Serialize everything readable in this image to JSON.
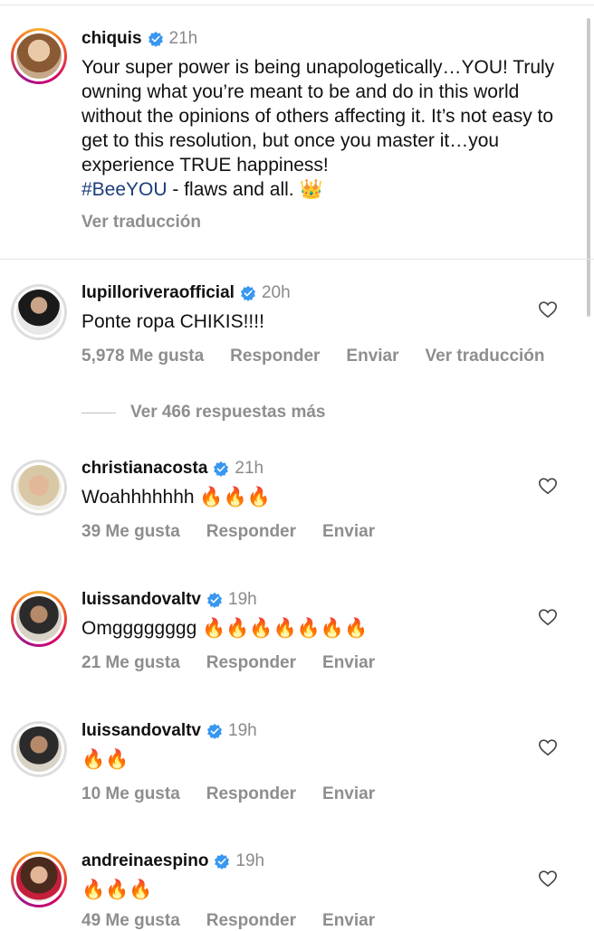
{
  "post": {
    "username": "chiquis",
    "time": "21h",
    "caption": "Your super power is being unapologetically…YOU! Truly owning what you’re meant to be and do in this world without the opinions of others affecting it. It’s not easy to get to this resolution, but once you master it…you experience TRUE happiness!",
    "hashtag": "#BeeYOU",
    "caption_end": " - flaws and all. 👑",
    "translate_label": "Ver traducción"
  },
  "comments": [
    {
      "username": "lupilloriveraofficial",
      "time": "20h",
      "text": "Ponte ropa CHIKIS!!!!",
      "likes": "5,978 Me gusta",
      "reply": "Responder",
      "send": "Enviar",
      "translate": "Ver traducción",
      "more_replies": "Ver 466 respuestas más"
    },
    {
      "username": "christianacosta",
      "time": "21h",
      "text": "Woahhhhhhh 🔥🔥🔥",
      "likes": "39 Me gusta",
      "reply": "Responder",
      "send": "Enviar"
    },
    {
      "username": "luissandovaltv",
      "time": "19h",
      "text": "Omgggggggg 🔥🔥🔥🔥🔥🔥🔥",
      "likes": "21 Me gusta",
      "reply": "Responder",
      "send": "Enviar"
    },
    {
      "username": "luissandovaltv",
      "time": "19h",
      "text": "🔥🔥",
      "likes": "10 Me gusta",
      "reply": "Responder",
      "send": "Enviar"
    },
    {
      "username": "andreinaespino",
      "time": "19h",
      "text": "🔥🔥🔥",
      "likes": "49 Me gusta",
      "reply": "Responder",
      "send": "Enviar"
    }
  ],
  "colors": {
    "verified": "#3897f0",
    "hashtag": "#1b3e79",
    "muted": "#8e8e8e"
  },
  "icons": [
    "verified-badge-icon",
    "heart-outline-icon",
    "crown-emoji",
    "fire-emoji"
  ]
}
